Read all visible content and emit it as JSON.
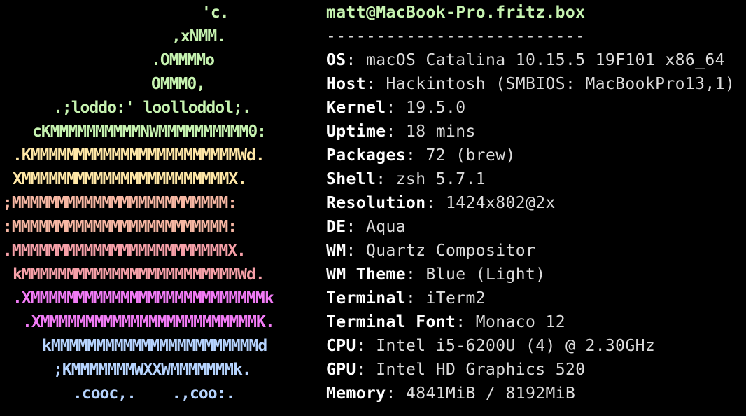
{
  "colors": {
    "background": "#000000",
    "green": "#c6f3b0",
    "yellow": "#ffe7a6",
    "peach": "#f7b7a3",
    "red": "#f6a0a8",
    "magenta": "#f27bf6",
    "lilac": "#c7c0ff",
    "blue": "#b6d4ff",
    "key": "#ffffff",
    "value": "#dcdcdc"
  },
  "logo": [
    {
      "text": "'c.",
      "color": "#c6f3b0"
    },
    {
      "text": ",xNMM.",
      "color": "#c6f3b0"
    },
    {
      "text": ".OMMMMo",
      "color": "#c6f3b0"
    },
    {
      "text": "OMMM0,",
      "color": "#c6f3b0"
    },
    {
      "text": ".;loddo:' loolloddol;.",
      "color": "#c6f3b0"
    },
    {
      "text": "cKMMMMMMMMMMNWMMMMMMMMMM0:",
      "color": "#c6f3b0"
    },
    {
      "text": ".KMMMMMMMMMMMMMMMMMMMMMMMWd.",
      "color": "#ffe7a6"
    },
    {
      "text": "XMMMMMMMMMMMMMMMMMMMMMMMX.",
      "color": "#ffe7a6"
    },
    {
      "text": ";MMMMMMMMMMMMMMMMMMMMMMMM:",
      "color": "#f7b7a3"
    },
    {
      "text": ":MMMMMMMMMMMMMMMMMMMMMMMM:",
      "color": "#f7b7a3"
    },
    {
      "text": ".MMMMMMMMMMMMMMMMMMMMMMMMX.",
      "color": "#f6a0a8"
    },
    {
      "text": "kMMMMMMMMMMMMMMMMMMMMMMMMWd.",
      "color": "#f6a0a8"
    },
    {
      "text": ".XMMMMMMMMMMMMMMMMMMMMMMMMMMk",
      "color": "#f27bf6"
    },
    {
      "text": ".XMMMMMMMMMMMMMMMMMMMMMMMMK.",
      "color": "#f27bf6"
    },
    {
      "text": "kMMMMMMMMMMMMMMMMMMMMMMMd",
      "color": "#b6d4ff"
    },
    {
      "text": ";KMMMMMMMWXXWMMMMMMMk.",
      "color": "#b6d4ff"
    },
    {
      "text": ".cooc,.    .,coo:.",
      "color": "#b6d4ff"
    }
  ],
  "header": {
    "user_host": "matt@MacBook-Pro.fritz.box",
    "dashes": "--------------------------"
  },
  "info": [
    {
      "key": "OS",
      "value": "macOS Catalina 10.15.5 19F101 x86_64"
    },
    {
      "key": "Host",
      "value": "Hackintosh (SMBIOS: MacBookPro13,1)"
    },
    {
      "key": "Kernel",
      "value": "19.5.0"
    },
    {
      "key": "Uptime",
      "value": "18 mins"
    },
    {
      "key": "Packages",
      "value": "72 (brew)"
    },
    {
      "key": "Shell",
      "value": "zsh 5.7.1"
    },
    {
      "key": "Resolution",
      "value": "1424x802@2x"
    },
    {
      "key": "DE",
      "value": "Aqua"
    },
    {
      "key": "WM",
      "value": "Quartz Compositor"
    },
    {
      "key": "WM Theme",
      "value": "Blue (Light)"
    },
    {
      "key": "Terminal",
      "value": "iTerm2"
    },
    {
      "key": "Terminal Font",
      "value": "Monaco 12"
    },
    {
      "key": "CPU",
      "value": "Intel i5-6200U (4) @ 2.30GHz"
    },
    {
      "key": "GPU",
      "value": "Intel HD Graphics 520"
    },
    {
      "key": "Memory",
      "value": "4841MiB / 8192MiB"
    }
  ]
}
